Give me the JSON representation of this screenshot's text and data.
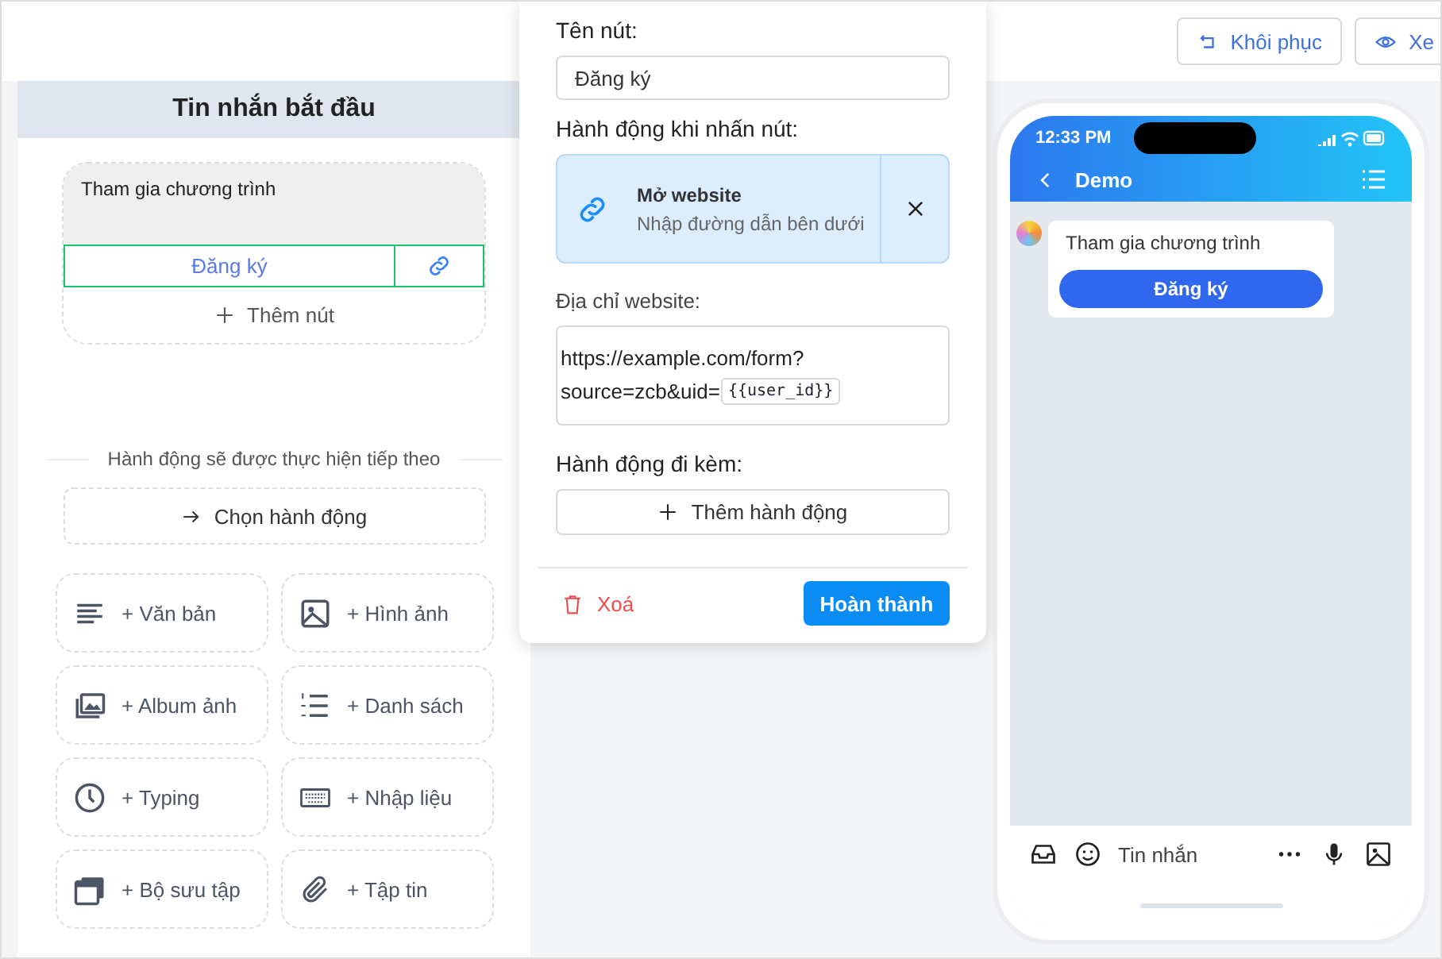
{
  "toolbar": {
    "buttons": [
      {
        "label": "Khôi phục",
        "kind": "restore"
      },
      {
        "label": "Xe",
        "kind": "preview"
      }
    ]
  },
  "editor": {
    "title": "Tin nhắn bắt đầu",
    "message": "Tham gia chương trình",
    "button": {
      "label": "Đăng ký",
      "selected": true
    },
    "add_button": "Thêm nút",
    "next_label": "Hành động sẽ được thực hiện tiếp theo",
    "choose_action": "Chọn hành động",
    "blocks": [
      {
        "label": "+ Văn bản",
        "kind": "text"
      },
      {
        "label": "+ Hình ảnh",
        "kind": "image"
      },
      {
        "label": "+ Album ảnh",
        "kind": "album"
      },
      {
        "label": "+ Danh sách",
        "kind": "list"
      },
      {
        "label": "+ Typing",
        "kind": "typing"
      },
      {
        "label": "+ Nhập liệu",
        "kind": "input"
      },
      {
        "label": "+ Bộ sưu tập",
        "kind": "gallery"
      },
      {
        "label": "+ Tập tin",
        "kind": "file"
      }
    ]
  },
  "popover": {
    "name_label": "Tên nút:",
    "name_value": "Đăng ký",
    "action_label": "Hành động khi nhấn nút:",
    "action": {
      "title": "Mở website",
      "subtitle": "Nhập đường dẫn bên dưới"
    },
    "url_label": "Địa chỉ website:",
    "url_lines": [
      "https://example.com/form?",
      "source=zcb&uid="
    ],
    "url_token": "{{user_id}}",
    "extra_label": "Hành động đi kèm:",
    "add_action": "Thêm hành động",
    "delete": "Xoá",
    "done": "Hoàn thành"
  },
  "phone": {
    "time": "12:33 PM",
    "chat_title": "Demo",
    "message": "Tham gia chương trình",
    "button": "Đăng ký",
    "input_placeholder": "Tin nhắn"
  }
}
